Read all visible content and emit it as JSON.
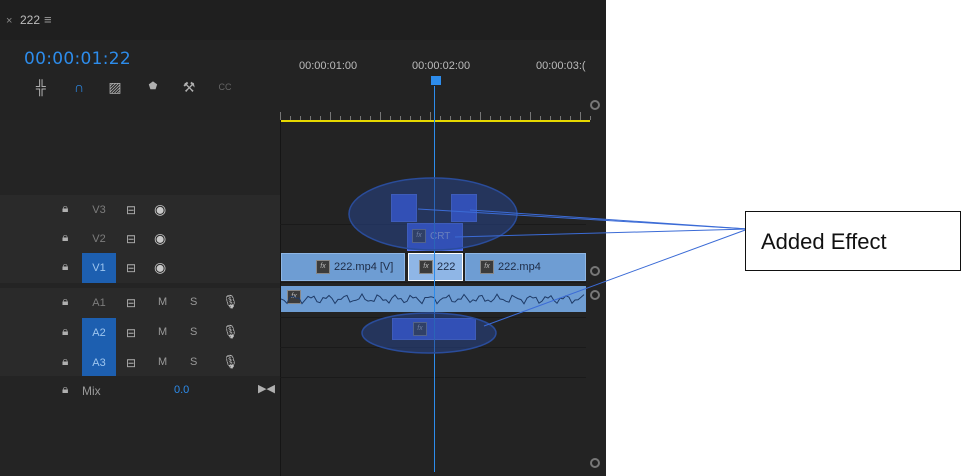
{
  "tab": {
    "close": "×",
    "title": "222",
    "menu": "≡"
  },
  "timecode": "00:00:01:22",
  "ruler": {
    "labels": [
      "00:00:01:00",
      "00:00:02:00",
      "00:00:03:("
    ]
  },
  "tracks": [
    {
      "name": "V3",
      "selected": false,
      "kind": "video"
    },
    {
      "name": "V2",
      "selected": false,
      "kind": "video"
    },
    {
      "name": "V1",
      "selected": true,
      "kind": "video"
    },
    {
      "name": "A1",
      "selected": false,
      "kind": "audio"
    },
    {
      "name": "A2",
      "selected": true,
      "kind": "audio"
    },
    {
      "name": "A3",
      "selected": true,
      "kind": "audio"
    }
  ],
  "audio_buttons": {
    "mute": "M",
    "solo": "S"
  },
  "mix": {
    "label": "Mix",
    "value": "0.0"
  },
  "clips": {
    "v1_a": "222.mp4 [V]",
    "v1_b": "222",
    "v1_c": "222.mp4",
    "v2_effect": "CRT"
  },
  "callout": {
    "label": "Added Effect"
  },
  "colors": {
    "accent": "#2d8ceb",
    "clip": "#6e9dd3",
    "adjustment": "#3e5ee8",
    "work_area": "#e6d800"
  },
  "icons": {
    "snap": "magnet-icon",
    "linked": "linked-selection-icon",
    "marker": "marker-icon",
    "wrench": "wrench-icon",
    "captions": "captions-icon",
    "insert": "insert-tool-icon"
  }
}
